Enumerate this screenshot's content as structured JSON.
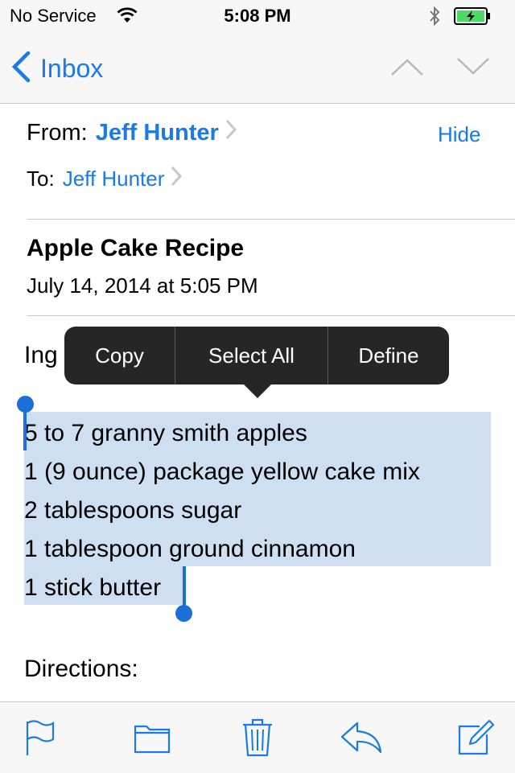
{
  "status_bar": {
    "carrier": "No Service",
    "time": "5:08 PM",
    "battery_color": "#4cd964"
  },
  "nav": {
    "back_label": "Inbox",
    "accent_color": "#1a7ae6"
  },
  "header": {
    "from_label": "From:",
    "from_name": "Jeff Hunter",
    "to_label": "To:",
    "to_name": "Jeff Hunter",
    "hide_label": "Hide",
    "subject": "Apple Cake Recipe",
    "date": "July 14, 2014 at 5:05 PM"
  },
  "body": {
    "ingredients_heading_visible": "Ing",
    "selected_lines": [
      "5 to 7 granny smith apples",
      "1 (9 ounce) package yellow cake mix",
      "2 tablespoons sugar",
      "1 tablespoon ground cinnamon",
      "1 stick butter"
    ],
    "directions_heading": "Directions:"
  },
  "context_menu": {
    "items": [
      "Copy",
      "Select All",
      "Define"
    ]
  },
  "toolbar": {
    "icons": [
      "flag-icon",
      "folder-icon",
      "trash-icon",
      "reply-icon",
      "compose-icon"
    ]
  }
}
